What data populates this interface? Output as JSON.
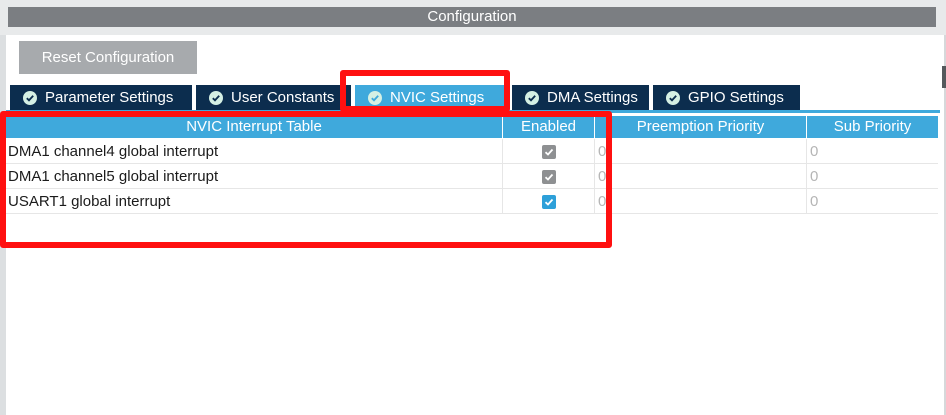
{
  "window": {
    "title": "Configuration"
  },
  "toolbar": {
    "reset_label": "Reset Configuration"
  },
  "tabs": [
    {
      "label": "Parameter Settings",
      "icon": "check-circle-icon",
      "active": false
    },
    {
      "label": "User Constants",
      "icon": "check-circle-icon",
      "active": false
    },
    {
      "label": "NVIC Settings",
      "icon": "check-circle-icon",
      "active": true
    },
    {
      "label": "DMA Settings",
      "icon": "check-circle-icon",
      "active": false
    },
    {
      "label": "GPIO Settings",
      "icon": "check-circle-icon",
      "active": false
    }
  ],
  "table": {
    "headers": {
      "name": "NVIC Interrupt Table",
      "enabled": "Enabled",
      "preemption": "Preemption Priority",
      "sub": "Sub Priority"
    },
    "rows": [
      {
        "name": "DMA1 channel4 global interrupt",
        "enabled": true,
        "editable": false,
        "preemption": "0",
        "sub": "0"
      },
      {
        "name": "DMA1 channel5 global interrupt",
        "enabled": true,
        "editable": false,
        "preemption": "0",
        "sub": "0"
      },
      {
        "name": "USART1 global interrupt",
        "enabled": true,
        "editable": true,
        "preemption": "0",
        "sub": "0"
      }
    ]
  },
  "colors": {
    "tab_active": "#3fa9dc",
    "tab_inactive": "#0c2d4e",
    "annotation": "#ff1010",
    "checkbox_locked": "#8e9092",
    "checkbox_active": "#2da0d9"
  }
}
